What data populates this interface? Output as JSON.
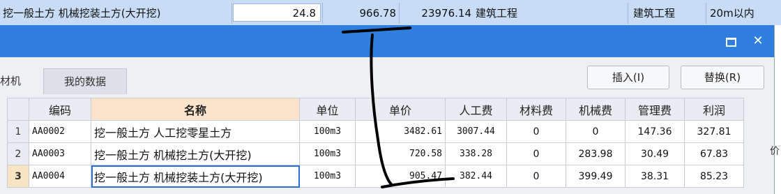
{
  "bg_row": {
    "name": "挖一般土方 机械挖装土方(大开挖)",
    "quantity": "24.8",
    "price": "966.78",
    "total": "23976.14",
    "category1": "建筑工程",
    "category2": "建筑工程",
    "range": "20m以内"
  },
  "dialog": {
    "tabs": [
      "材机",
      "我的数据"
    ],
    "buttons": {
      "insert": "插入(I)",
      "replace": "替换(R)"
    }
  },
  "table": {
    "columns": [
      "",
      "编码",
      "名称",
      "单位",
      "单价",
      "人工费",
      "材料费",
      "机械费",
      "管理费",
      "利润"
    ],
    "rows": [
      {
        "n": "1",
        "code": "AA0002",
        "name": "挖一般土方 人工挖零星土方",
        "unit": "100m3",
        "price": "3482.61",
        "labor": "3007.44",
        "material": "0",
        "machine": "0",
        "mgmt": "147.36",
        "profit": "327.81"
      },
      {
        "n": "2",
        "code": "AA0003",
        "name": "挖一般土方 机械挖土方(大开挖)",
        "unit": "100m3",
        "price": "720.58",
        "labor": "338.28",
        "material": "0",
        "machine": "283.98",
        "mgmt": "30.49",
        "profit": "67.83"
      },
      {
        "n": "3",
        "code": "AA0004",
        "name": "挖一般土方 机械挖装土方(大开挖)",
        "unit": "100m3",
        "price": "905.47",
        "labor": "382.44",
        "material": "0",
        "machine": "399.49",
        "mgmt": "38.31",
        "profit": "85.23"
      }
    ]
  },
  "edge_text": "价",
  "colors": {
    "titlebar": "#2e7fe0",
    "selected_row": "#f8e3c5",
    "name_header": "#fce3cc",
    "ink": "#000000"
  }
}
